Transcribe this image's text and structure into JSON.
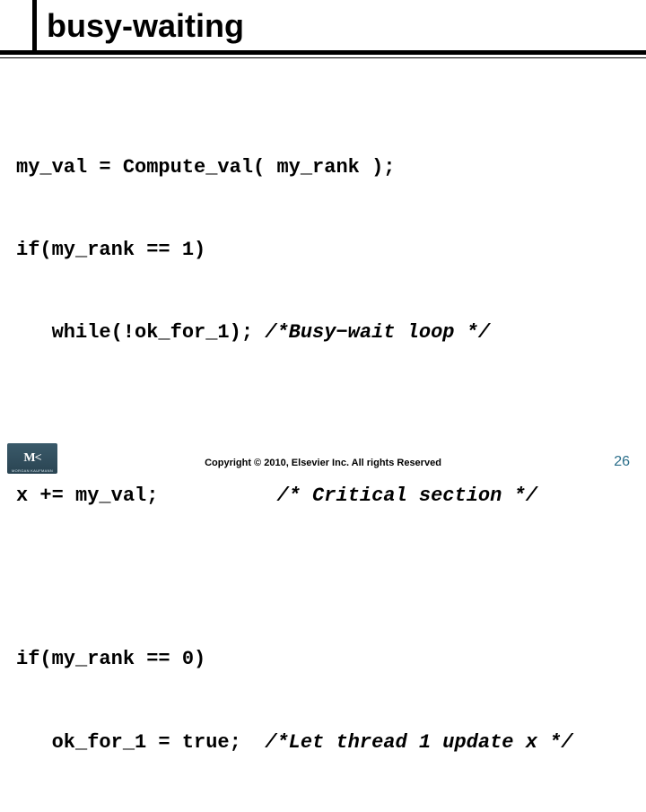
{
  "title": "busy-waiting",
  "code": {
    "l1": "my_val = Compute_val( my_rank );",
    "l2": "if(my_rank == 1)",
    "l3_code": "   while(!ok_for_1); ",
    "l3_comment": "/*Busy−wait loop */",
    "l4_code": "x += my_val;          ",
    "l4_comment": "/* Critical section */",
    "l5": "if(my_rank == 0)",
    "l6_code": "   ok_for_1 = true;  ",
    "l6_comment": "/*Let thread 1 update x */"
  },
  "footer": {
    "logo_text": "M<",
    "logo_sub": "MORGAN KAUFMANN",
    "copyright": "Copyright © 2010, Elsevier Inc. All rights Reserved",
    "page": "26"
  }
}
